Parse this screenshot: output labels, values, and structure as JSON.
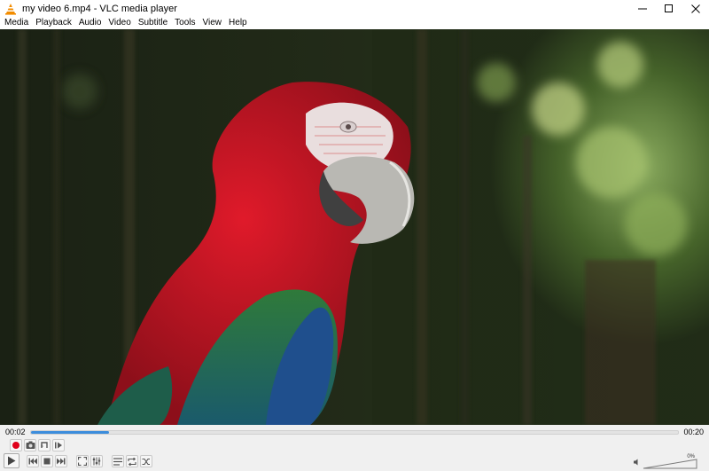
{
  "window": {
    "title": "my video 6.mp4 - VLC media player",
    "accent": "#f28c00"
  },
  "menu": {
    "items": [
      "Media",
      "Playback",
      "Audio",
      "Video",
      "Subtitle",
      "Tools",
      "View",
      "Help"
    ]
  },
  "player": {
    "time_elapsed": "00:02",
    "time_total": "00:20",
    "progress_fraction": 0.12,
    "seek_color": "#3c8ddc",
    "volume_label": "0%",
    "volume_fraction": 0.0
  },
  "icons": {
    "record": "record-icon",
    "snapshot": "camera-icon",
    "loop_ab": "loop-ab-icon",
    "frame_step": "frame-step-icon",
    "play": "play-icon",
    "previous": "previous-icon",
    "stop": "stop-icon",
    "next": "next-icon",
    "fullscreen": "fullscreen-icon",
    "extended": "extended-settings-icon",
    "playlist": "playlist-icon",
    "loop": "loop-icon",
    "shuffle": "shuffle-icon",
    "volume": "speaker-icon"
  }
}
